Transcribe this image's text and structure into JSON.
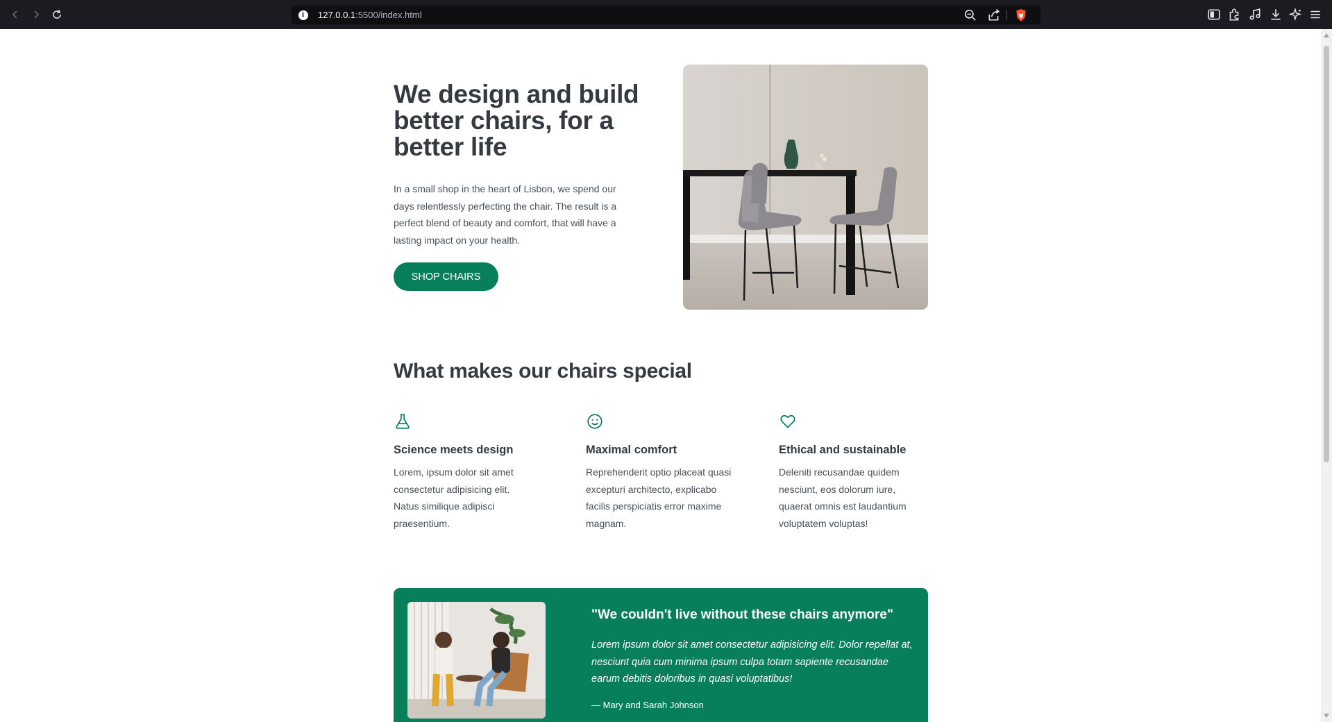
{
  "browser": {
    "url_host": "127.0.0.1",
    "url_path": ":5500/index.html"
  },
  "hero": {
    "title": "We design and build better chairs, for a better life",
    "text": "In a small shop in the heart of Lisbon, we spend our days relentlessly perfecting the chair. The result is a perfect blend of beauty and comfort, that will have a lasting impact on your health.",
    "button_label": "SHOP CHAIRS"
  },
  "features": {
    "title": "What makes our chairs special",
    "items": [
      {
        "icon": "flask-icon",
        "title": "Science meets design",
        "text": "Lorem, ipsum dolor sit amet consectetur adipisicing elit. Natus similique adipisci praesentium."
      },
      {
        "icon": "smile-icon",
        "title": "Maximal comfort",
        "text": "Reprehenderit optio placeat quasi excepturi architecto, explicabo facilis perspiciatis error maxime magnam."
      },
      {
        "icon": "heart-icon",
        "title": "Ethical and sustainable",
        "text": "Deleniti recusandae quidem nesciunt, eos dolorum iure, quaerat omnis est laudantium voluptatem voluptas!"
      }
    ]
  },
  "testimonial": {
    "quote": "\"We couldn't live without these chairs anymore\"",
    "text": "Lorem ipsum dolor sit amet consectetur adipisicing elit. Dolor repellat at, nesciunt quia cum minima ipsum culpa totam sapiente recusandae earum debitis doloribus in quasi voluptatibus!",
    "author": "— Mary and Sarah Johnson"
  },
  "colors": {
    "brand": "#087f5b",
    "text_dark": "#343a40",
    "text_body": "#495057"
  }
}
